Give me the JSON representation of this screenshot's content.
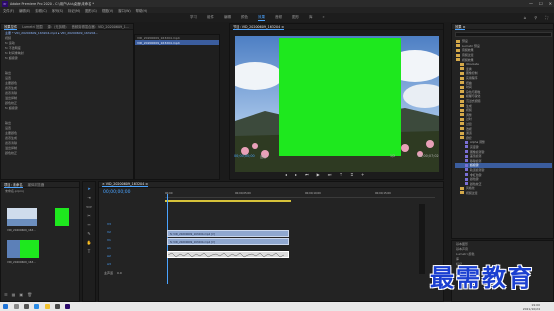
{
  "app": {
    "title": "Adobe Premiere Pro 2020 - C:\\用户\\Alu\\桌面\\未命名 *",
    "window_controls": [
      "—",
      "☐",
      "✕"
    ]
  },
  "menu": [
    "文件(F)",
    "编辑(E)",
    "剪辑(C)",
    "序列(S)",
    "标记(M)",
    "图形(G)",
    "视图(V)",
    "窗口(W)",
    "帮助(H)"
  ],
  "workspaces": {
    "tabs": [
      "学习",
      "组件",
      "编辑",
      "颜色",
      "效果",
      "音频",
      "图形",
      "库"
    ],
    "active": "效果",
    "more": "»"
  },
  "effect_controls": {
    "tabs": [
      "效果控件",
      "Lumetri 范围",
      "源：(无剪辑)",
      "音频剪辑混合器：VID_20200609_1..."
    ],
    "source_line": "主要 * VID_20200609_163204.mp4 ▸ VID_20200609_163204...",
    "rows": [
      "视频",
      "fx 运动",
      "fx 不透明度",
      "fx 时间重映射",
      "fx 超级键",
      "",
      "",
      "输出",
      "设置",
      "主要颜色",
      "遮罩生成",
      "遮罩清除",
      "溢出抑制",
      "颜色校正",
      "fx 超级键",
      "",
      "",
      "输出",
      "设置",
      "主要颜色",
      "遮罩生成",
      "遮罩清除",
      "溢出抑制",
      "颜色校正"
    ],
    "values": {
      "output": "合成",
      "setting": "默认"
    },
    "timecode": "00;00;00;00"
  },
  "source_list": {
    "header": "VID_20200609_163204.mp4",
    "item": "VID_20200609_163204.mp4"
  },
  "program_monitor": {
    "tab": "节目: VID_20200609_163204 ≡",
    "timecode_left": "00;00;00;00",
    "fit": "适合",
    "fraction": "1/2",
    "timecode_right": "00;00;07;02"
  },
  "project": {
    "tabs": [
      "项目: 未命名",
      "媒体浏览器"
    ],
    "file": "未命名.prproj",
    "thumbs": [
      {
        "label": "VID_20200609_163...",
        "dur": "7;02"
      },
      {
        "label": "VID_20200609_163...",
        "dur": "7;02"
      }
    ]
  },
  "timeline": {
    "tab": "× VID_20200609_163204 ≡",
    "timecode": "00;00;00;00",
    "ruler": [
      "00;00",
      "00;00;05;00",
      "00;00;10;00",
      "00;00;15;00"
    ],
    "tracks_v": [
      "V3",
      "V2",
      "V1"
    ],
    "tracks_a": [
      "A1",
      "A2",
      "A3"
    ],
    "master": "主声道",
    "master_value": "0.0",
    "clips": [
      "fx VID_20200609_163204.mp4 [V]",
      "fx VID_20200609_163204.mp4 [V]"
    ]
  },
  "effects": {
    "title": "效果 ≡",
    "search": "",
    "tree": [
      "预设",
      "Lumetri 预设",
      "音频效果",
      "音频过渡",
      "视频效果",
      "Obsolete",
      "变换",
      "图像控制",
      "实用程序",
      "扭曲",
      "时间",
      "杂色与颗粒",
      "模糊与锐化",
      "沉浸式视频",
      "生成",
      "视频",
      "调整",
      "过时",
      "过渡",
      "透视",
      "通道",
      "键控",
      "Alpha 调整",
      "亮度键",
      "图像遮罩键",
      "差值遮罩",
      "移除遮罩",
      "超级键",
      "轨道遮罩键",
      "非红色键",
      "颜色键",
      "颜色校正",
      "风格化",
      "视频过渡"
    ],
    "bottom": [
      "基本图形",
      "基本声音",
      "Lumetri 颜色",
      "库",
      "标记",
      "历史记录",
      "信息"
    ]
  },
  "taskbar": {
    "time": "19:00",
    "date": "2021/10/24"
  },
  "watermark": "最需教育",
  "colors": {
    "accent": "#4aa3ff",
    "green_screen": "#1ee81e",
    "clip": "#8fa7cf"
  }
}
